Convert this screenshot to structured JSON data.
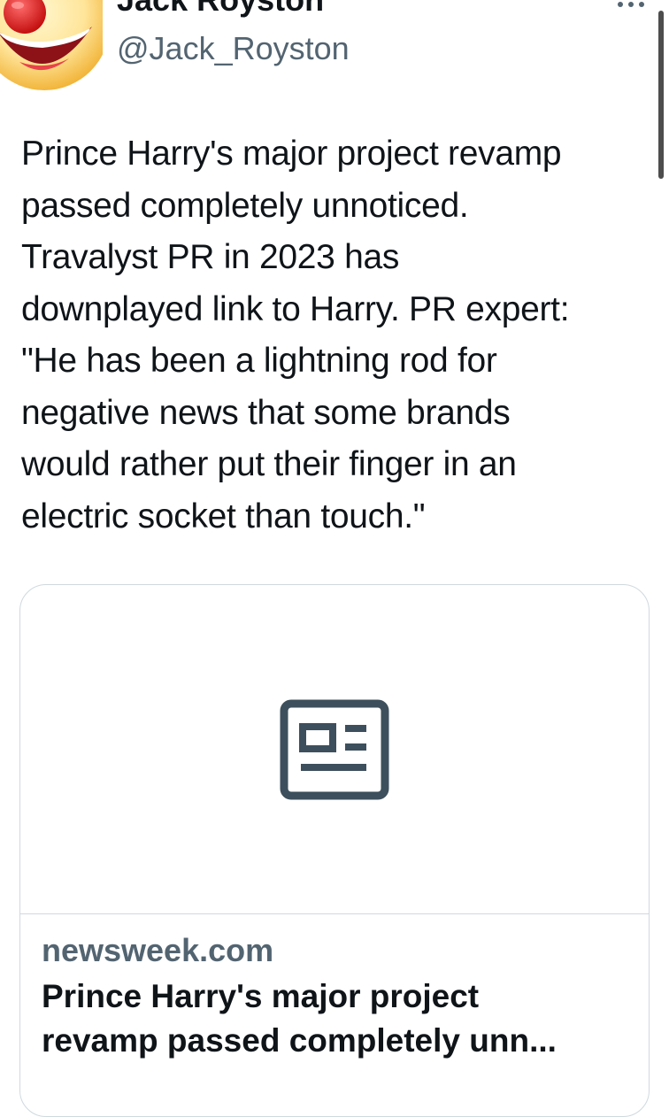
{
  "author": {
    "display_name": "Jack Royston",
    "handle": "@Jack_Royston",
    "avatar_icon": "clown-face-avatar"
  },
  "header": {
    "more_icon": "more-horizontal-icon"
  },
  "tweet": {
    "text": "Prince Harry's major project revamp\npassed completely unnoticed.\nTravalyst PR in 2023 has\ndownplayed link to Harry. PR expert:\n\"He has been a lightning rod for\nnegative news that some brands\nwould rather put their finger in an\nelectric socket than touch.\""
  },
  "link_card": {
    "media_icon": "article-icon",
    "domain": "newsweek.com",
    "title_line1": "Prince Harry's major project",
    "title_line2": "revamp passed completely unn..."
  },
  "colors": {
    "text_primary": "#0f1419",
    "text_secondary": "#536471",
    "border": "#cfd9de",
    "icon": "#3d4f5c"
  }
}
